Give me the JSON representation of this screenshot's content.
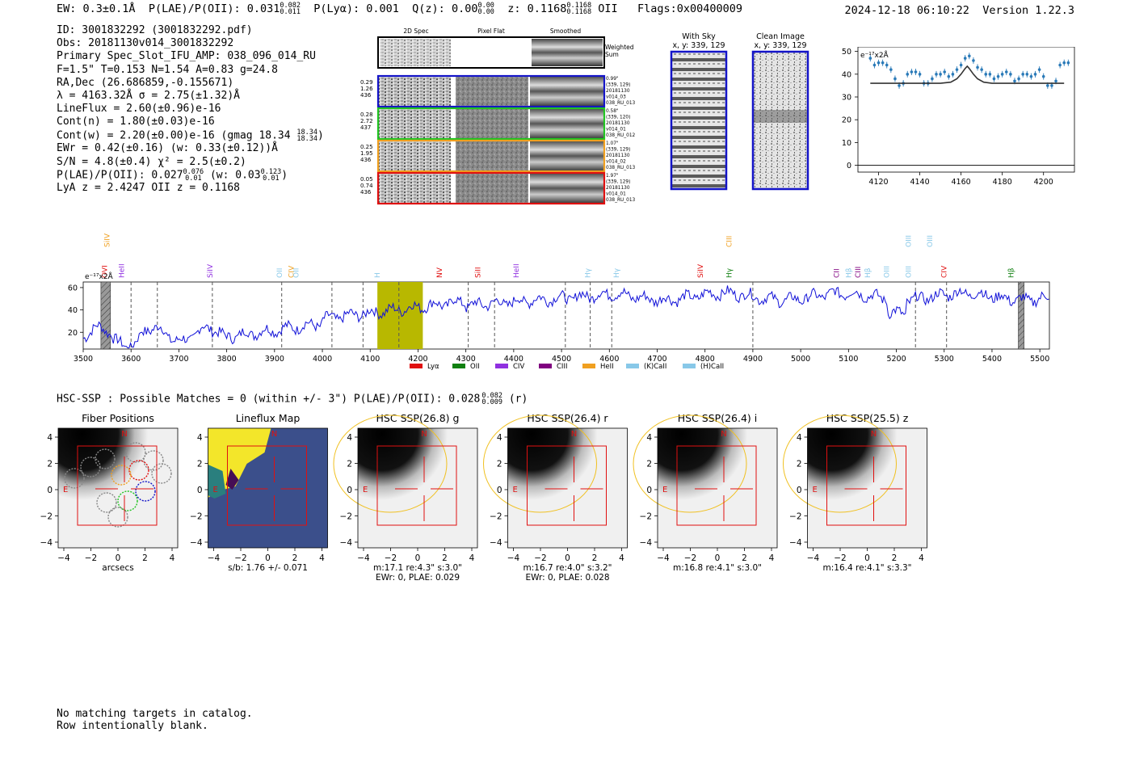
{
  "header": {
    "ew": "EW: 0.3±0.1Å",
    "plae_label": "P(LAE)/P(OII): 0.031",
    "plae_hi": "0.082",
    "plae_lo": "0.011",
    "plya": "P(Lyα): 0.001",
    "qz_label": "Q(z): 0.00",
    "qz_hi": "0.00",
    "qz_lo": "0.00",
    "z_label": "z: 0.1168",
    "z_hi": "0.1168",
    "z_lo": "0.1168",
    "z_line": "OII",
    "flags": "Flags:0x00400009",
    "timestamp": "2024-12-18 06:10:22",
    "version": "Version 1.22.3"
  },
  "info": {
    "id": "ID: 3001832292 (3001832292.pdf)",
    "obs": "Obs: 20181130v014_3001832292",
    "primary": "Primary Spec_Slot_IFU_AMP: 038_096_014_RU",
    "params": "F=1.5\"  T=0.153  N=1.54  A=0.83  g=24.8",
    "radec": "RA,Dec (26.686859,-0.155671)",
    "lambda": "λ = 4163.32Å   σ = 2.75(±1.32)Å",
    "lineflux": "LineFlux = 2.60(±0.96)e-16",
    "contn": "Cont(n) = 1.80(±0.03)e-16",
    "contw": "Cont(w) = 2.20(±0.00)e-16 (gmag 18.34",
    "contw_hi": "18.34",
    "contw_lo": "18.34",
    "ewr": "EWr = 0.42(±0.16)  (w: 0.33(±0.12))Å",
    "sn": "S/N = 4.8(±0.4)  χ² = 2.5(±0.2)",
    "plae": "P(LAE)/P(OII): 0.027",
    "plae_hi": "0.076",
    "plae_lo": "0.01",
    "plae_w": "(w: 0.03",
    "plae_w_hi": "0.123",
    "plae_w_lo": "0.01",
    "lya": "LyA z = 2.4247   OII z = 0.1168"
  },
  "stamps": {
    "col_2d": "2D Spec",
    "col_flat": "Pixel Flat",
    "col_smooth": "Smoothed",
    "weighted": "Weighted",
    "sum": "Sum",
    "rows": [
      {
        "left": [
          "0.29",
          "1.26",
          "436"
        ],
        "right": [
          "0.99\"",
          "(339, 129)",
          "20181130",
          "v014_03",
          "038_RU_013"
        ],
        "color": "#1414c8"
      },
      {
        "left": [
          "0.28",
          "2.72",
          "437"
        ],
        "right": [
          "0.58\"",
          "(339, 120)",
          "20181130",
          "v014_01",
          "038_RU_012"
        ],
        "color": "#22c422"
      },
      {
        "left": [
          "0.25",
          "1.95",
          "436"
        ],
        "right": [
          "1.07\"",
          "(339, 129)",
          "20181130",
          "v014_02",
          "038_RU_013"
        ],
        "color": "#f0a020"
      },
      {
        "left": [
          "0.05",
          "0.74",
          "436"
        ],
        "right": [
          "1.97\"",
          "(339, 129)",
          "20181130",
          "v014_01",
          "038_RU_013"
        ],
        "color": "#e01010"
      }
    ],
    "with_sky": "With Sky",
    "with_sky_xy": "x, y: 339, 129",
    "clean": "Clean Image",
    "clean_xy": "x, y: 339, 129"
  },
  "zoom_chart": {
    "unit": "e⁻¹⁷x2Å",
    "yticks": [
      "0",
      "10",
      "20",
      "30",
      "40",
      "50"
    ],
    "xticks": [
      "4120",
      "4140",
      "4160",
      "4180",
      "4200"
    ]
  },
  "chart_data": [
    {
      "type": "line",
      "title": "",
      "xlabel": "",
      "ylabel": "e⁻¹⁷x2Å",
      "xlim": [
        4110,
        4215
      ],
      "ylim": [
        -3,
        52
      ],
      "series": [
        {
          "x": [
            4116,
            4118,
            4120,
            4122,
            4124,
            4126,
            4128,
            4130,
            4132,
            4134,
            4136,
            4138,
            4140,
            4142,
            4144,
            4146,
            4148,
            4150,
            4152,
            4154,
            4156,
            4158,
            4160,
            4162,
            4164,
            4166,
            4168,
            4170,
            4172,
            4174,
            4176,
            4178,
            4180,
            4182,
            4184,
            4186,
            4188,
            4190,
            4192,
            4194,
            4196,
            4198,
            4200,
            4202,
            4204,
            4206,
            4208,
            4210,
            4212
          ],
          "y": [
            47,
            44,
            45,
            45,
            44,
            42,
            38,
            35,
            36,
            40,
            41,
            41,
            40,
            36,
            36,
            38,
            40,
            40,
            41,
            39,
            40,
            42,
            44,
            47,
            48,
            46,
            43,
            42,
            40,
            40,
            38,
            39,
            40,
            41,
            40,
            37,
            38,
            40,
            40,
            39,
            40,
            42,
            39,
            35,
            35,
            37,
            44,
            45,
            45
          ]
        },
        {
          "x": [
            4116,
            4150,
            4155,
            4158,
            4160,
            4162,
            4163,
            4164,
            4166,
            4168,
            4171,
            4175,
            4210
          ],
          "y": [
            36,
            36,
            36.5,
            38,
            40,
            42.5,
            43.5,
            42.5,
            40,
            38,
            36.5,
            36,
            36
          ]
        }
      ]
    },
    {
      "type": "line",
      "title": "",
      "xlabel": "",
      "ylabel": "e⁻¹⁷x2Å",
      "xlim": [
        3500,
        5520
      ],
      "ylim": [
        5,
        65
      ],
      "x_ticks": [
        3500,
        3600,
        3700,
        3800,
        3900,
        4000,
        4100,
        4200,
        4300,
        4400,
        4500,
        4600,
        4700,
        4800,
        4900,
        5000,
        5100,
        5200,
        5300,
        5400,
        5500
      ],
      "y_ticks": [
        20,
        40,
        60
      ],
      "highlight": [
        4115,
        4210
      ],
      "line_marks": [
        3600,
        3655,
        3770,
        3915,
        4020,
        4085,
        4160,
        4305,
        4360,
        4508,
        4560,
        4605,
        4900,
        5240,
        5305
      ],
      "legend": [
        "Lyα",
        "OII",
        "CIV",
        "CIII",
        "HeII",
        "(K)CaII",
        "(H)CaII"
      ],
      "legend_colors": [
        "#e01010",
        "#108010",
        "#9030e0",
        "#800080",
        "#f0a020",
        "#88c8e8",
        "#88c8e8"
      ],
      "species": [
        {
          "name": "SiIV",
          "x": 3550,
          "c": "#f0a020",
          "row": 0
        },
        {
          "name": "OVI",
          "x": 3545,
          "c": "#e01010",
          "row": 1
        },
        {
          "name": "HeII",
          "x": 3580,
          "c": "#9030e0",
          "row": 1
        },
        {
          "name": "SiIV",
          "x": 3765,
          "c": "#9030e0",
          "row": 1
        },
        {
          "name": "OII",
          "x": 3910,
          "c": "#88c8e8",
          "row": 1
        },
        {
          "name": "CIV",
          "x": 3935,
          "c": "#f0a020",
          "row": 1
        },
        {
          "name": "OII",
          "x": 3945,
          "c": "#88c8e8",
          "row": 1
        },
        {
          "name": "H",
          "x": 4115,
          "c": "#88c8e8",
          "row": 1
        },
        {
          "name": "NV",
          "x": 4245,
          "c": "#e01010",
          "row": 1
        },
        {
          "name": "SiII",
          "x": 4325,
          "c": "#e01010",
          "row": 1
        },
        {
          "name": "HeII",
          "x": 4405,
          "c": "#9030e0",
          "row": 1
        },
        {
          "name": "Hγ",
          "x": 4555,
          "c": "#88c8e8",
          "row": 1
        },
        {
          "name": "Hγ",
          "x": 4615,
          "c": "#88c8e8",
          "row": 1
        },
        {
          "name": "SiIV",
          "x": 4790,
          "c": "#e01010",
          "row": 1
        },
        {
          "name": "Hγ",
          "x": 4850,
          "c": "#108010",
          "row": 1
        },
        {
          "name": "CIII",
          "x": 4850,
          "c": "#f0a020",
          "row": 0
        },
        {
          "name": "CII",
          "x": 5075,
          "c": "#800080",
          "row": 1
        },
        {
          "name": "Hβ",
          "x": 5100,
          "c": "#88c8e8",
          "row": 1
        },
        {
          "name": "CIII",
          "x": 5120,
          "c": "#800080",
          "row": 1
        },
        {
          "name": "Hβ",
          "x": 5140,
          "c": "#88c8e8",
          "row": 1
        },
        {
          "name": "OIII",
          "x": 5180,
          "c": "#88c8e8",
          "row": 1
        },
        {
          "name": "OIII",
          "x": 5225,
          "c": "#88c8e8",
          "row": 1
        },
        {
          "name": "OIII",
          "x": 5225,
          "c": "#88c8e8",
          "row": 0
        },
        {
          "name": "OIII",
          "x": 5270,
          "c": "#88c8e8",
          "row": 0
        },
        {
          "name": "CIV",
          "x": 5300,
          "c": "#e01010",
          "row": 1
        },
        {
          "name": "Hβ",
          "x": 5440,
          "c": "#108010",
          "row": 1
        }
      ]
    }
  ],
  "hsc": {
    "summary": "HSC-SSP : Possible Matches = 0 (within +/- 3\")  P(LAE)/P(OII): 0.028",
    "summary_hi": "0.082",
    "summary_lo": "0.009",
    "summary_band": "(r)",
    "axis_ticks": [
      "4",
      "2",
      "0",
      "−2",
      "−4"
    ],
    "x_ticks": [
      "−4",
      "−2",
      "0",
      "2",
      "4"
    ],
    "panels": [
      {
        "title": "Fiber Positions",
        "cap1": "arcsecs",
        "cap2": ""
      },
      {
        "title": "Lineflux Map",
        "cap1": "s/b: 1.76 +/- 0.071",
        "cap2": ""
      },
      {
        "title": "HSC SSP(26.8) g",
        "cap1": "m:17.1  re:4.3\"  s:3.0\"",
        "cap2": "EWr: 0, PLAE: 0.029"
      },
      {
        "title": "HSC SSP(26.4) r",
        "cap1": "m:16.7  re:4.0\"  s:3.2\"",
        "cap2": "EWr: 0, PLAE: 0.028"
      },
      {
        "title": "HSC SSP(26.4) i",
        "cap1": "m:16.8  re:4.1\"  s:3.0\"",
        "cap2": ""
      },
      {
        "title": "HSC SSP(25.5) z",
        "cap1": "m:16.4  re:4.1\"  s:3.3\"",
        "cap2": ""
      }
    ],
    "n_label": "N",
    "e_label": "E"
  },
  "footer": {
    "line1": "No matching targets in catalog.",
    "line2": "Row intentionally blank."
  }
}
